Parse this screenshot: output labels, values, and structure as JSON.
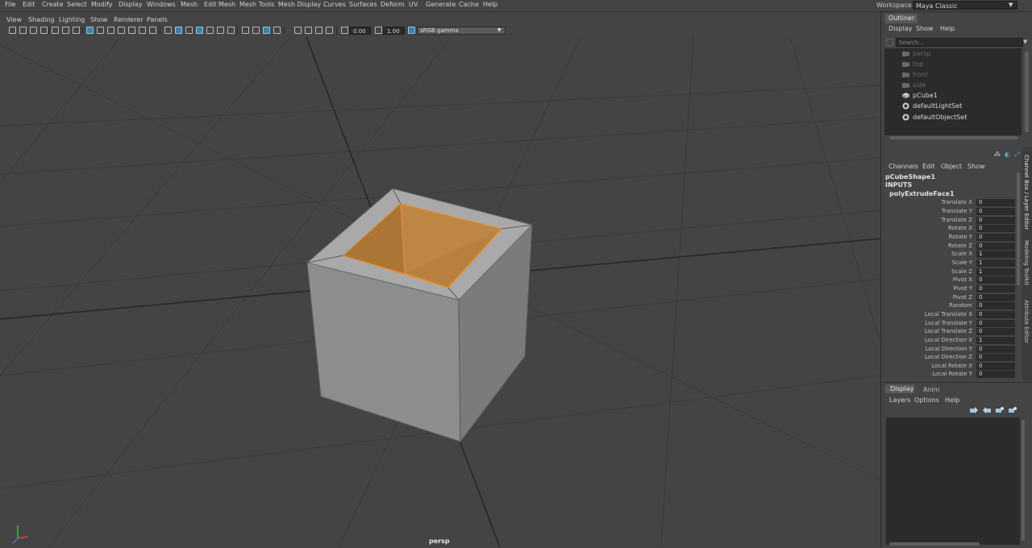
{
  "menubar": {
    "items": [
      "File",
      "Edit",
      "Create",
      "Select",
      "Modify",
      "Display",
      "Windows",
      "Mesh",
      "Edit Mesh",
      "Mesh Tools",
      "Mesh Display",
      "Curves",
      "Surfaces",
      "Deform",
      "UV",
      "Generate",
      "Cache",
      "Help"
    ],
    "workspace_label": "Workspace :",
    "workspace_value": "Maya Classic"
  },
  "viewport": {
    "panel_menu": [
      "View",
      "Shading",
      "Lighting",
      "Show",
      "Renderer",
      "Panels"
    ],
    "exposure": "0.00",
    "gamma": "1.00",
    "color_space": "sRGB gamma",
    "camera_label": "persp"
  },
  "outliner": {
    "tab": "Outliner",
    "menu": [
      "Display",
      "Show",
      "Help"
    ],
    "search_placeholder": "Search...",
    "items": [
      {
        "label": "persp",
        "type": "camera-icon",
        "dim": true
      },
      {
        "label": "top",
        "type": "camera-icon",
        "dim": true
      },
      {
        "label": "front",
        "type": "camera-icon",
        "dim": true
      },
      {
        "label": "side",
        "type": "camera-icon",
        "dim": true
      },
      {
        "label": "pCube1",
        "type": "mesh-icon",
        "dim": false
      },
      {
        "label": "defaultLightSet",
        "type": "set-icon",
        "dim": false
      },
      {
        "label": "defaultObjectSet",
        "type": "set-icon",
        "dim": false
      }
    ]
  },
  "channel_box": {
    "menu": [
      "Channels",
      "Edit",
      "Object",
      "Show"
    ],
    "object_name": "pCubeShape1",
    "inputs_label": "INPUTS",
    "node_name": "polyExtrudeFace1",
    "attributes": [
      {
        "label": "Translate X",
        "value": "0"
      },
      {
        "label": "Translate Y",
        "value": "0"
      },
      {
        "label": "Translate Z",
        "value": "0"
      },
      {
        "label": "Rotate X",
        "value": "0"
      },
      {
        "label": "Rotate Y",
        "value": "0"
      },
      {
        "label": "Rotate Z",
        "value": "0"
      },
      {
        "label": "Scale X",
        "value": "1"
      },
      {
        "label": "Scale Y",
        "value": "1"
      },
      {
        "label": "Scale Z",
        "value": "1"
      },
      {
        "label": "Pivot X",
        "value": "0"
      },
      {
        "label": "Pivot Y",
        "value": "0"
      },
      {
        "label": "Pivot Z",
        "value": "0"
      },
      {
        "label": "Random",
        "value": "0"
      },
      {
        "label": "Local Translate X",
        "value": "0"
      },
      {
        "label": "Local Translate Y",
        "value": "0"
      },
      {
        "label": "Local Translate Z",
        "value": "0"
      },
      {
        "label": "Local Direction X",
        "value": "1"
      },
      {
        "label": "Local Direction Y",
        "value": "0"
      },
      {
        "label": "Local Direction Z",
        "value": "0"
      },
      {
        "label": "Local Rotate X",
        "value": "0"
      },
      {
        "label": "Local Rotate Y",
        "value": "0"
      }
    ]
  },
  "side_tabs": [
    "Channel Box / Layer Editor",
    "Modeling Toolkit",
    "Attribute Editor"
  ],
  "layer_editor": {
    "tabs": [
      "Display",
      "Anim"
    ],
    "menu": [
      "Layers",
      "Options",
      "Help"
    ]
  },
  "colors": {
    "selection": "#e8922e",
    "selection_fill": "#b8803f",
    "active_button": "#3d7fa6"
  }
}
